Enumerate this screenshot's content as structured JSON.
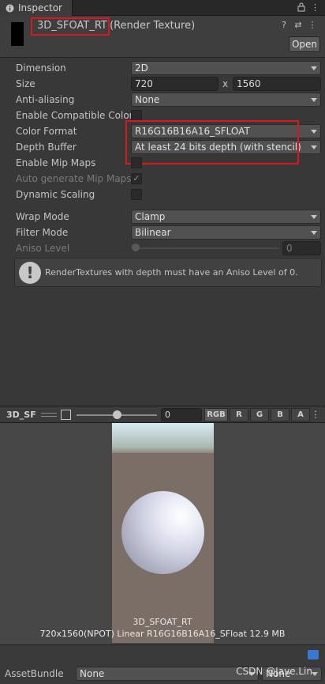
{
  "tab": {
    "label": "Inspector"
  },
  "header": {
    "asset_name": "3D_SFOAT_RT",
    "asset_type": "(Render Texture)",
    "open_label": "Open"
  },
  "properties": {
    "dimension": {
      "label": "Dimension",
      "value": "2D"
    },
    "size": {
      "label": "Size",
      "width": "720",
      "sep": "x",
      "height": "1560"
    },
    "anti_aliasing": {
      "label": "Anti-aliasing",
      "value": "None"
    },
    "enable_compat_color": {
      "label": "Enable Compatible Color F",
      "checked": false
    },
    "color_format": {
      "label": "Color Format",
      "value": "R16G16B16A16_SFLOAT"
    },
    "depth_buffer": {
      "label": "Depth Buffer",
      "value": "At least 24 bits depth (with stencil)"
    },
    "enable_mip_maps": {
      "label": "Enable Mip Maps",
      "checked": false
    },
    "auto_generate_mip": {
      "label": "Auto generate Mip Maps",
      "checked": true
    },
    "dynamic_scaling": {
      "label": "Dynamic Scaling",
      "checked": false
    },
    "wrap_mode": {
      "label": "Wrap Mode",
      "value": "Clamp"
    },
    "filter_mode": {
      "label": "Filter Mode",
      "value": "Bilinear"
    },
    "aniso_level": {
      "label": "Aniso Level",
      "value": "0"
    }
  },
  "help": {
    "message": "RenderTextures with depth must have an Aniso Level of 0."
  },
  "preview": {
    "title": "3D_SF",
    "mip_value": "0",
    "channels": [
      "RGB",
      "R",
      "G",
      "B",
      "A"
    ],
    "texture_name": "3D_SFOAT_RT",
    "texture_info": "720x1560(NPOT) Linear  R16G16B16A16_SFloat  12.9 MB"
  },
  "asset_bundle": {
    "label": "AssetBundle",
    "name_value": "None",
    "variant_value": "None"
  },
  "watermark": "CSDN @Jave.Lin"
}
